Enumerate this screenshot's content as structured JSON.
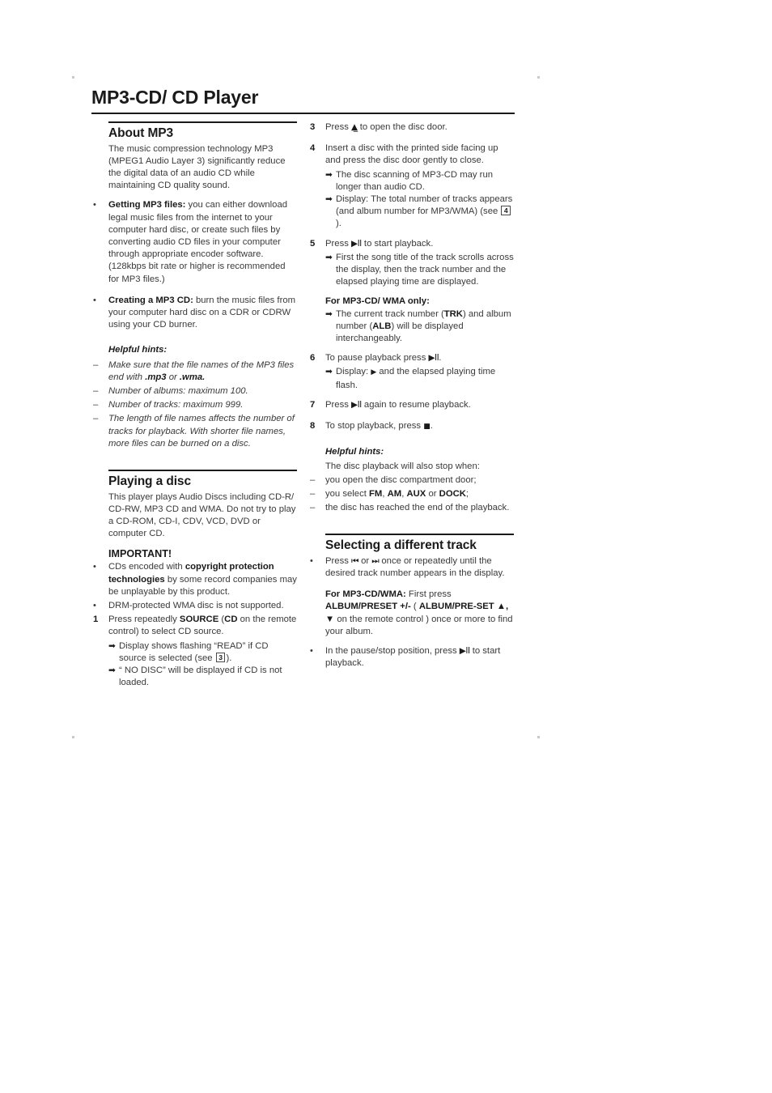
{
  "page": {
    "title": "MP3-CD/ CD Player"
  },
  "left_column": {
    "about": {
      "heading": "About MP3",
      "intro": "The music compression technology MP3 (MPEG1 Audio Layer 3) significantly reduce the digital data of an audio CD while maintaining CD quality sound.",
      "bullets": [
        {
          "lead": "Getting MP3 files:",
          "text": " you can either download legal music files from the internet to your computer hard disc, or create such files by converting audio CD files in your computer through appropriate encoder software. (128kbps bit rate or higher is recommended for MP3 files.)"
        },
        {
          "lead": "Creating a MP3 CD:",
          "text": " burn the music files from your computer hard disc on a CDR or CDRW using your CD burner."
        }
      ],
      "hints_heading": "Helpful hints:",
      "hints": [
        {
          "pre": "Make sure that the file names of the MP3 files end with ",
          "bold1": ".mp3",
          "mid": " or ",
          "bold2": ".wma.",
          "post": ""
        },
        {
          "pre": "Number of albums: maximum 100.",
          "bold1": "",
          "mid": "",
          "bold2": "",
          "post": ""
        },
        {
          "pre": "Number of tracks: maximum 999.",
          "bold1": "",
          "mid": "",
          "bold2": "",
          "post": ""
        },
        {
          "pre": "The length of file names affects the number of tracks for playback. With shorter file names, more files can be burned on a disc.",
          "bold1": "",
          "mid": "",
          "bold2": "",
          "post": ""
        }
      ]
    },
    "playing": {
      "heading": "Playing a disc",
      "intro": "This player plays Audio Discs including CD-R/ CD-RW, MP3 CD and WMA. Do not try to play a CD-ROM, CD-I, CDV, VCD, DVD or computer CD.",
      "important_heading": "IMPORTANT!",
      "important_bullets": [
        {
          "pre": "CDs encoded with ",
          "bold": "copyright protection technologies",
          "post": " by some record companies may be unplayable by this product."
        },
        {
          "pre": "DRM-protected WMA disc is not supported.",
          "bold": "",
          "post": ""
        }
      ],
      "step1": {
        "number": "1",
        "pre": "Press repeatedly ",
        "bold1": "SOURCE",
        "mid1": " (",
        "bold2": "CD",
        "post": " on the remote control) to select CD source.",
        "sub": [
          {
            "pre": "Display shows flashing “READ” if CD source is selected (see ",
            "boxnum": "3",
            "post": ")."
          },
          {
            "pre": "“ NO DISC” will be displayed if CD is not loaded.",
            "boxnum": "",
            "post": ""
          }
        ]
      }
    }
  },
  "right_column": {
    "step3": {
      "number": "3",
      "pre": "Press ",
      "glyph": "▲̲",
      "post": " to open the disc door."
    },
    "step4": {
      "number": "4",
      "text": "Insert a disc with the printed side facing up and press the disc door gently to close.",
      "sub": [
        {
          "pre": "The disc scanning of MP3-CD may run longer than audio CD.",
          "boxnum": "",
          "post": ""
        },
        {
          "pre": "Display: The total number of tracks appears (and album number for MP3/WMA) (see ",
          "boxnum": "4",
          "post": ")."
        }
      ]
    },
    "step5": {
      "number": "5",
      "pre": "Press ",
      "glyph": "▶II",
      "post": " to start playback.",
      "sub": [
        "First the song title of the track scrolls across the display, then the track number and the elapsed playing time are displayed."
      ],
      "mp3_heading": "For MP3-CD/ WMA only:",
      "mp3_sub": {
        "pre": "The current track number (",
        "bold1": "TRK",
        "mid": ") and album number (",
        "bold2": "ALB",
        "post": ") will be displayed interchangeably."
      }
    },
    "step6": {
      "number": "6",
      "pre": "To pause playback press  ",
      "glyph": "▶II",
      "post": ".",
      "sub": {
        "pre": "Display: ",
        "glyph": "▶",
        "post": " and the elapsed playing time flash."
      }
    },
    "step7": {
      "number": "7",
      "pre": "Press  ",
      "glyph": "▶II",
      "post": "  again to resume playback."
    },
    "step8": {
      "number": "8",
      "pre": "To stop playback, press ",
      "glyph": "■",
      "post": "."
    },
    "hints_heading": "Helpful hints:",
    "hints_intro": "The disc playback will also stop when:",
    "hints": [
      {
        "pre": "you open the disc compartment door;",
        "bold1": "",
        "mid1": "",
        "bold2": "",
        "mid2": "",
        "bold3": "",
        "mid3": "",
        "bold4": "",
        "post": ""
      },
      {
        "pre": "you select ",
        "bold1": "FM",
        "mid1": ", ",
        "bold2": "AM",
        "mid2": ", ",
        "bold3": "AUX",
        "mid3": " or ",
        "bold4": "DOCK",
        "post": ";"
      },
      {
        "pre": "the disc has reached the end of the playback.",
        "bold1": "",
        "mid1": "",
        "bold2": "",
        "mid2": "",
        "bold3": "",
        "mid3": "",
        "bold4": "",
        "post": ""
      }
    ],
    "selecting": {
      "heading": "Selecting a different track",
      "bullet1": {
        "pre": "Press ",
        "glyph1": "⏮",
        "mid": " or ",
        "glyph2": "⏭",
        "post": " once or repeatedly until the desired track number appears in the display."
      },
      "mp3_block": {
        "bold_head": "For MP3-CD/WMA:",
        "normal1": " First press ",
        "bold1": "ALBUM/PRESET +/-",
        "normal2": " ( ",
        "bold2": "ALBUM/PRE-SET ▲, ▼",
        "normal3": " on the remote control ) once or more to find your album."
      },
      "bullet2": {
        "pre": "In the pause/stop position, press ",
        "glyph": "▶II",
        "post": "  to start playback."
      }
    }
  }
}
